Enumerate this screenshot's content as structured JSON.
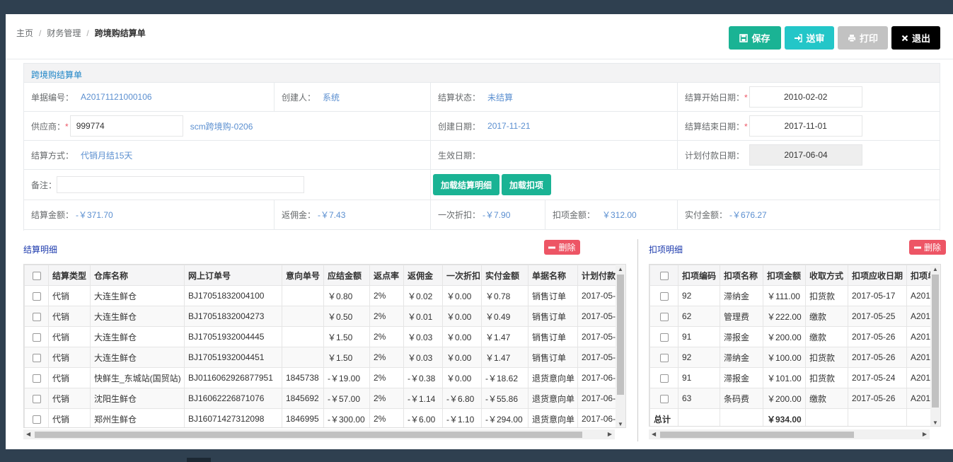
{
  "breadcrumb": [
    "主页",
    "财务管理",
    "跨境购结算单"
  ],
  "toolbar": {
    "save": "保存",
    "submit": "送审",
    "print": "打印",
    "exit": "退出"
  },
  "panel_title": "跨境购结算单",
  "form": {
    "doc_no_label": "单据编号：",
    "doc_no": "A20171121000106",
    "creator_label": "创建人：",
    "creator": "系统",
    "status_label": "结算状态：",
    "status": "未结算",
    "start_date_label": "结算开始日期：",
    "start_date": "2010-02-02",
    "supplier_label": "供应商：",
    "supplier_code": "999774",
    "supplier_name": "scm跨境购-0206",
    "created_label": "创建日期：",
    "created": "2017-11-21",
    "end_date_label": "结算结束日期：",
    "end_date": "2017-11-01",
    "method_label": "结算方式：",
    "method": "代销月结15天",
    "effective_label": "生效日期：",
    "plan_pay_label": "计划付款日期：",
    "plan_pay": "2017-06-04",
    "remark_label": "备注：",
    "load_detail": "加载结算明细",
    "load_deduct": "加载扣项",
    "settle_amt_label": "结算金额：",
    "settle_amt": "-￥371.70",
    "rebate_label": "返佣金：",
    "rebate": "-￥7.43",
    "discount_label": "一次折扣：",
    "discount": "-￥7.90",
    "deduct_label": "扣项金额：",
    "deduct": "￥312.00",
    "actual_label": "实付金额：",
    "actual": "-￥676.27"
  },
  "detail": {
    "title": "结算明细",
    "delete": "删除",
    "columns": [
      "结算类型",
      "仓库名称",
      "网上订单号",
      "意向单号",
      "应结金额",
      "返点率",
      "返佣金",
      "一次折扣",
      "实付金额",
      "单据名称",
      "计划付款"
    ],
    "rows": [
      [
        "代销",
        "大连生鲜仓",
        "BJ17051832004100",
        "",
        "￥0.80",
        "2%",
        "￥0.02",
        "￥0.00",
        "￥0.78",
        "销售订单",
        "2017-05-"
      ],
      [
        "代销",
        "大连生鲜仓",
        "BJ17051832004273",
        "",
        "￥0.50",
        "2%",
        "￥0.01",
        "￥0.00",
        "￥0.49",
        "销售订单",
        "2017-05-"
      ],
      [
        "代销",
        "大连生鲜仓",
        "BJ17051932004445",
        "",
        "￥1.50",
        "2%",
        "￥0.03",
        "￥0.00",
        "￥1.47",
        "销售订单",
        "2017-05-"
      ],
      [
        "代销",
        "大连生鲜仓",
        "BJ17051932004451",
        "",
        "￥1.50",
        "2%",
        "￥0.03",
        "￥0.00",
        "￥1.47",
        "销售订单",
        "2017-05-"
      ],
      [
        "代销",
        "快鲜生_东城站(国贸站)",
        "BJ0116062926877951",
        "1845738",
        "-￥19.00",
        "2%",
        "-￥0.38",
        "￥0.00",
        "-￥18.62",
        "退货意向单",
        "2017-06-"
      ],
      [
        "代销",
        "沈阳生鲜仓",
        "BJ16062226871076",
        "1845692",
        "-￥57.00",
        "2%",
        "-￥1.14",
        "-￥6.80",
        "-￥55.86",
        "退货意向单",
        "2017-06-"
      ],
      [
        "代销",
        "郑州生鲜仓",
        "BJ16071427312098",
        "1846995",
        "-￥300.00",
        "2%",
        "-￥6.00",
        "-￥1.10",
        "-￥294.00",
        "退货意向单",
        "2017-06-"
      ]
    ]
  },
  "deduct_table": {
    "title": "扣项明细",
    "delete": "删除",
    "columns": [
      "扣项编码",
      "扣项名称",
      "扣项金额",
      "收取方式",
      "扣项应收日期",
      "扣项单"
    ],
    "rows": [
      [
        "92",
        "滞纳金",
        "￥111.00",
        "扣货款",
        "2017-05-17",
        "A201"
      ],
      [
        "62",
        "管理费",
        "￥222.00",
        "缴款",
        "2017-05-25",
        "A201"
      ],
      [
        "91",
        "滞报金",
        "￥200.00",
        "缴款",
        "2017-05-26",
        "A201"
      ],
      [
        "92",
        "滞纳金",
        "￥100.00",
        "扣货款",
        "2017-05-26",
        "A201"
      ],
      [
        "91",
        "滞报金",
        "￥101.00",
        "扣货款",
        "2017-05-24",
        "A201"
      ],
      [
        "63",
        "条码费",
        "￥200.00",
        "缴款",
        "2017-05-26",
        "A201"
      ]
    ],
    "total_label": "总计",
    "total_amount": "￥934.00"
  },
  "colors": {
    "primary": "#1ab394",
    "info": "#23c6c8",
    "danger": "#ed5565",
    "link": "#5b8fd0",
    "sidebar": "#2f4050"
  },
  "icons": {
    "save": "floppy-icon",
    "submit": "sign-in-icon",
    "print": "printer-icon",
    "exit": "close-icon",
    "delete": "minus-circle-icon"
  }
}
